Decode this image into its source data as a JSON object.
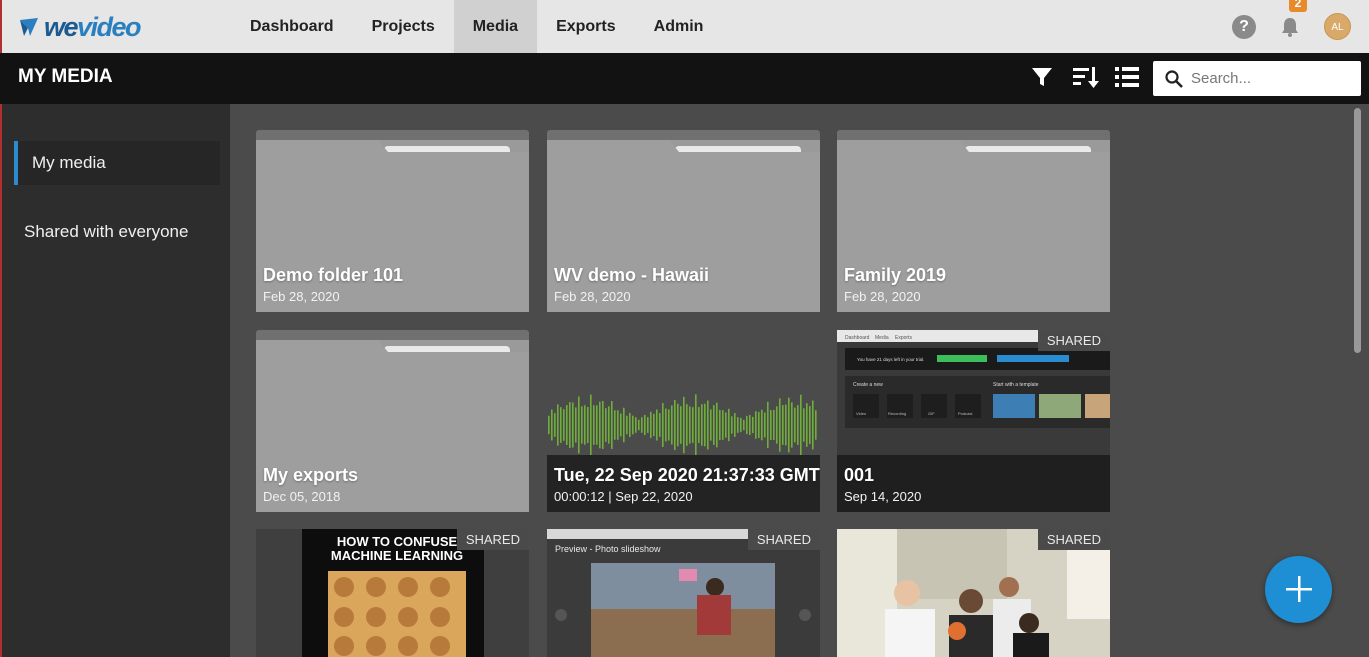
{
  "brand": {
    "name_we": "we",
    "name_video": "video"
  },
  "nav": {
    "items": [
      {
        "label": "Dashboard",
        "active": false
      },
      {
        "label": "Projects",
        "active": false
      },
      {
        "label": "Media",
        "active": true
      },
      {
        "label": "Exports",
        "active": false
      },
      {
        "label": "Admin",
        "active": false
      }
    ],
    "help_label": "?",
    "notification_count": "2",
    "avatar_initials": "AL"
  },
  "header": {
    "title": "MY MEDIA",
    "search_placeholder": "Search..."
  },
  "sidebar": {
    "items": [
      {
        "label": "My media",
        "active": true
      },
      {
        "label": "Shared with everyone",
        "active": false
      }
    ]
  },
  "grid": {
    "folders": [
      {
        "title": "Demo folder 101",
        "date": "Feb 28, 2020"
      },
      {
        "title": "WV demo - Hawaii",
        "date": "Feb 28, 2020"
      },
      {
        "title": "Family 2019",
        "date": "Feb 28, 2020"
      },
      {
        "title": "My exports",
        "date": "Dec 05, 2018"
      }
    ],
    "media": [
      {
        "title": "Tue, 22 Sep 2020 21:37:33 GMT",
        "meta": "00:00:12 | Sep 22, 2020",
        "kind": "audio"
      },
      {
        "title": "001",
        "meta": "Sep 14, 2020",
        "kind": "screenshot",
        "badge": "SHARED"
      }
    ],
    "bottom_row": [
      {
        "kind": "meme",
        "badge": "SHARED",
        "meme_text": "HOW TO CONFUSE MACHINE LEARNING"
      },
      {
        "kind": "slideshow",
        "badge": "SHARED",
        "preview_text": "Preview - Photo slideshow"
      },
      {
        "kind": "photo",
        "badge": "SHARED"
      }
    ]
  },
  "screenshot_thumb": {
    "tabs": [
      "Dashboard",
      "Media",
      "Exports"
    ],
    "trial_text": "You have 21 days left in your trial.",
    "create_new": "Create a new",
    "start_template": "Start with a template",
    "tiles": [
      "Video",
      "Recording",
      "GIF",
      "Podcast"
    ]
  },
  "colors": {
    "accent": "#2a8bd0",
    "fab": "#1e8fd4",
    "badge": "#e88a2a",
    "waveform": "#6fae3a"
  }
}
